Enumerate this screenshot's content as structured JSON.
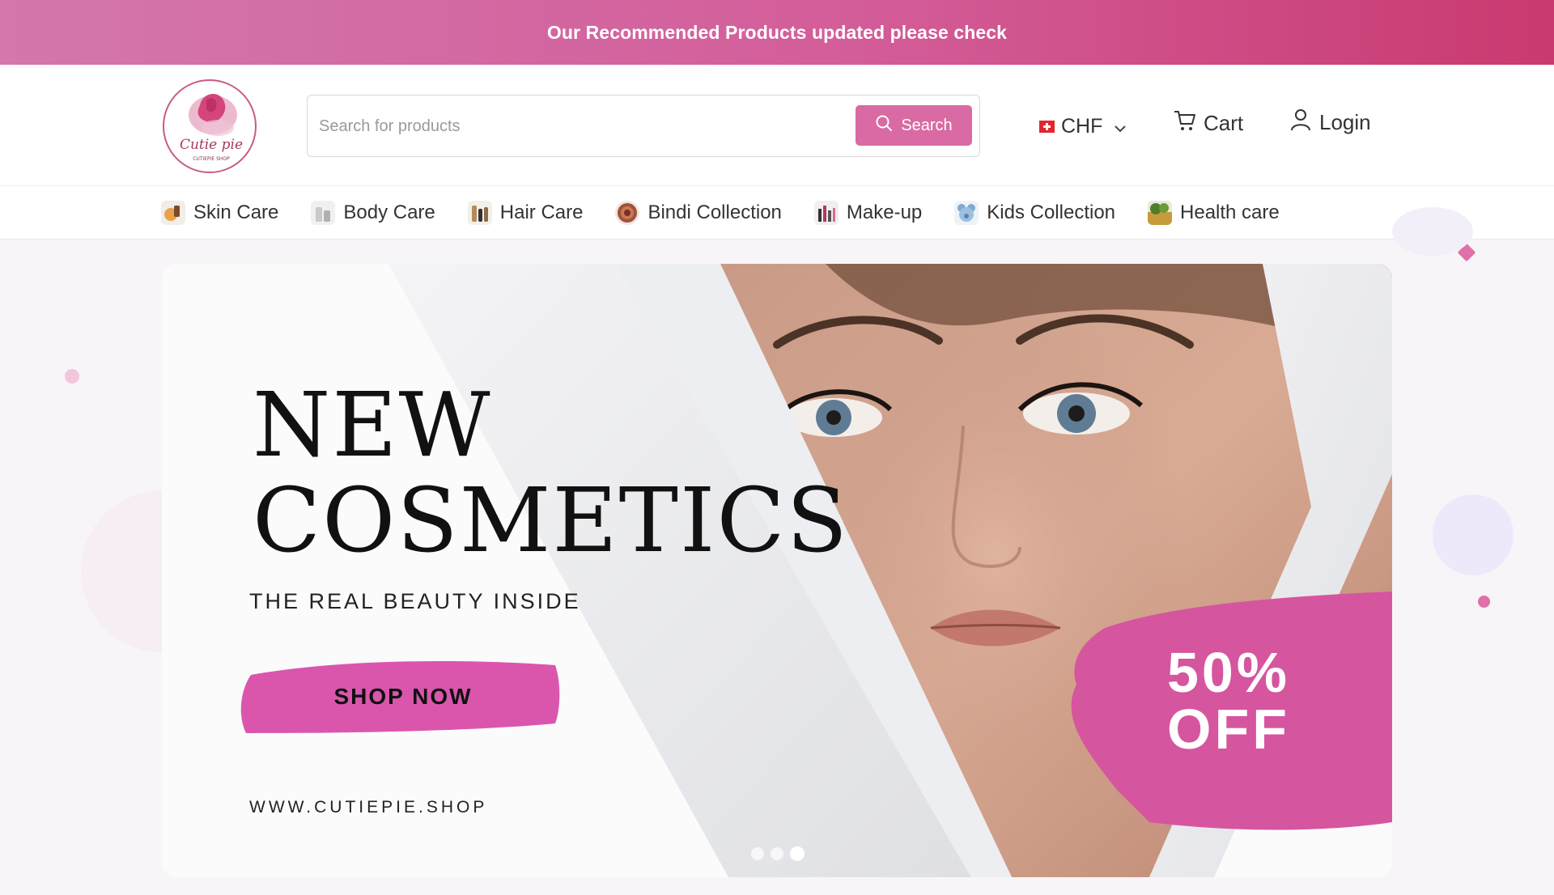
{
  "announcement": {
    "text": "Our Recommended Products updated please check"
  },
  "header": {
    "logo": {
      "script": "Cutie pie",
      "small": "CUTIEPIE SHOP"
    },
    "search": {
      "placeholder": "Search for products",
      "value": "",
      "button_label": "Search"
    },
    "currency": {
      "code": "CHF",
      "flag": "switzerland-flag"
    },
    "cart_label": "Cart",
    "login_label": "Login"
  },
  "categories": [
    {
      "label": "Skin Care",
      "icon": "skin-care-icon"
    },
    {
      "label": "Body Care",
      "icon": "body-care-icon"
    },
    {
      "label": "Hair Care",
      "icon": "hair-care-icon"
    },
    {
      "label": "Bindi Collection",
      "icon": "bindi-icon"
    },
    {
      "label": "Make-up",
      "icon": "makeup-icon"
    },
    {
      "label": "Kids Collection",
      "icon": "kids-icon"
    },
    {
      "label": "Health care",
      "icon": "health-care-icon"
    }
  ],
  "hero": {
    "title_line1": "NEW",
    "title_line2": "COSMETICS",
    "subtitle": "THE REAL BEAUTY INSIDE",
    "cta_label": "SHOP NOW",
    "url": "WWW.CUTIEPIE.SHOP",
    "offer_line1": "50%",
    "offer_line2": "OFF",
    "slides": 3,
    "active_slide": 3
  },
  "colors": {
    "brand_pink": "#d96aa3",
    "accent_magenta": "#d6559f",
    "announce_start": "#d377ad",
    "announce_end": "#c93a70"
  }
}
